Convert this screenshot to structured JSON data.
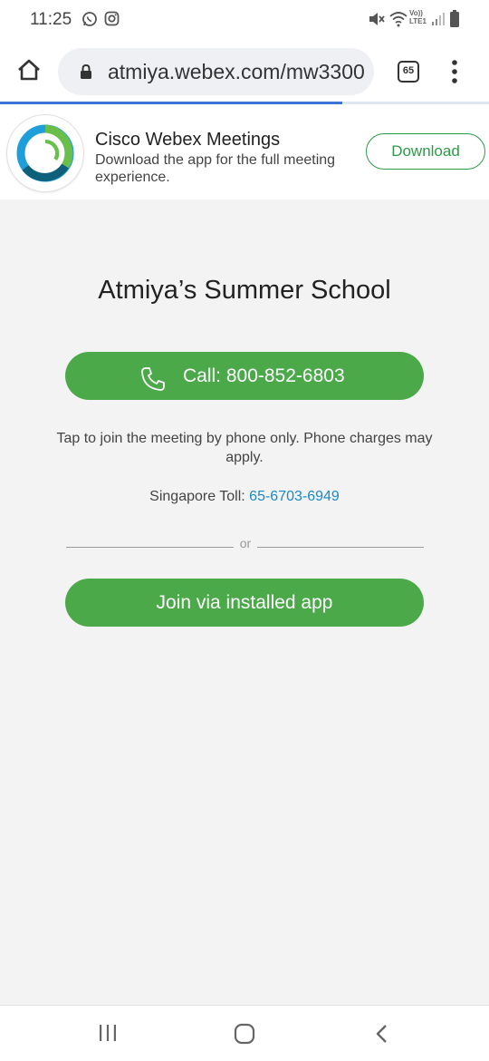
{
  "status_bar": {
    "time": "11:25",
    "lte_line1": "Vo))",
    "lte_line2": "LTE1"
  },
  "browser": {
    "url": "atmiya.webex.com/mw3300",
    "tab_count": "65",
    "page_load_progress": 0.7
  },
  "app_banner": {
    "title": "Cisco Webex Meetings",
    "description": "Download the app for the full meeting experience.",
    "download_label": "Download"
  },
  "meeting": {
    "title": "Atmiya’s Summer School",
    "call_label": "Call: 800-852-6803",
    "phone_note": "Tap to join the meeting by phone only. Phone charges may apply.",
    "toll_label": "Singapore Toll: ",
    "toll_number": "65-6703-6949",
    "or_label": "or",
    "join_label": "Join via installed app"
  },
  "colors": {
    "accent_green": "#4ba94a",
    "link_blue": "#1a8ac5",
    "progress_blue": "#3b73d8"
  },
  "icons": [
    "whatsapp-icon",
    "instagram-icon",
    "mute-icon",
    "wifi-icon",
    "signal-icon",
    "battery-icon",
    "home-icon",
    "lock-icon",
    "tabs-icon",
    "menu-icon",
    "webex-logo",
    "phone-icon",
    "recents-icon",
    "nav-home-icon",
    "back-icon"
  ]
}
